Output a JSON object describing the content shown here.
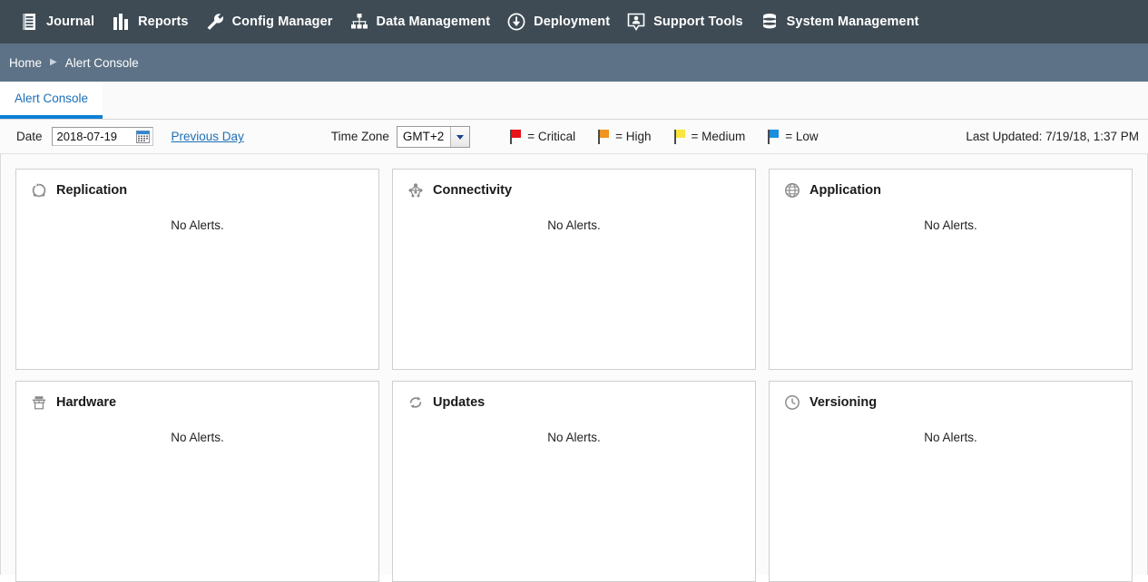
{
  "navbar": {
    "items": [
      {
        "label": "Journal",
        "icon": "journal-icon"
      },
      {
        "label": "Reports",
        "icon": "bar-chart-icon"
      },
      {
        "label": "Config Manager",
        "icon": "wrench-icon"
      },
      {
        "label": "Data Management",
        "icon": "hierarchy-icon"
      },
      {
        "label": "Deployment",
        "icon": "download-cloud-icon"
      },
      {
        "label": "Support Tools",
        "icon": "user-badge-icon"
      },
      {
        "label": "System Management",
        "icon": "database-icon"
      }
    ],
    "background": "#3e4b54"
  },
  "breadcrumb": {
    "home": "Home",
    "separator": "▶",
    "current": "Alert Console",
    "background": "#5d7286"
  },
  "tabs": [
    {
      "label": "Alert Console",
      "active": true,
      "accent": "#0b7fd4"
    }
  ],
  "toolbar": {
    "date_label": "Date",
    "date_value": "2018-07-19",
    "date_placeholder": "yyyy-mm-dd",
    "previous_day_label": "Previous Day",
    "timezone_label": "Time Zone",
    "timezone_value": "GMT+2",
    "timezone_options": [
      "GMT+2"
    ],
    "last_updated": "Last Updated: 7/19/18, 1:37 PM",
    "legend": [
      {
        "label": "= Critical",
        "color": "#e8121a"
      },
      {
        "label": "= High",
        "color": "#f0961e"
      },
      {
        "label": "= Medium",
        "color": "#fae63c"
      },
      {
        "label": "= Low",
        "color": "#1a8fe0"
      }
    ]
  },
  "panels": [
    {
      "title": "Replication",
      "icon": "sync-circle-icon",
      "body": "No Alerts."
    },
    {
      "title": "Connectivity",
      "icon": "network-nodes-icon",
      "body": "No Alerts."
    },
    {
      "title": "Application",
      "icon": "globe-icon",
      "body": "No Alerts."
    },
    {
      "title": "Hardware",
      "icon": "printer-icon",
      "body": "No Alerts."
    },
    {
      "title": "Updates",
      "icon": "refresh-icon",
      "body": "No Alerts."
    },
    {
      "title": "Versioning",
      "icon": "clock-icon",
      "body": "No Alerts."
    }
  ]
}
